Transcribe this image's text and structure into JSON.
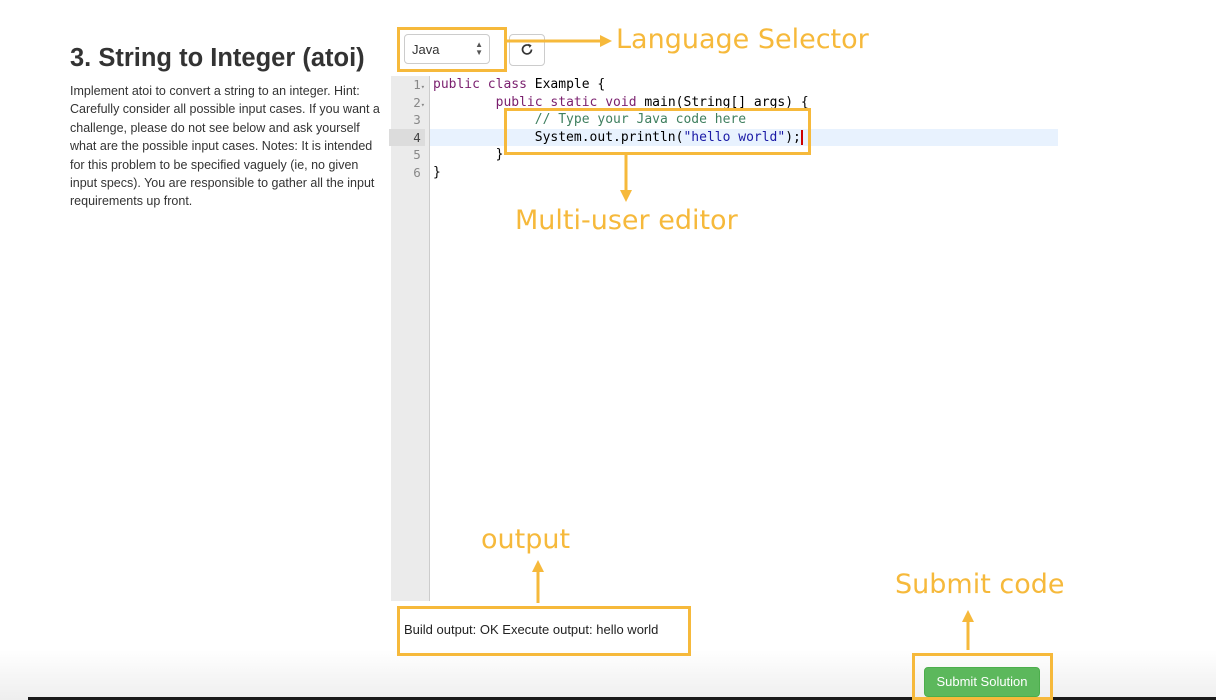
{
  "problem": {
    "title": "3. String to Integer (atoi)",
    "description": "Implement atoi to convert a string to an integer. Hint: Carefully consider all possible input cases. If you want a challenge, please do not see below and ask yourself what are the possible input cases. Notes: It is intended for this problem to be specified vaguely (ie, no given input specs). You are responsible to gather all the input requirements up front."
  },
  "toolbar": {
    "language_value": "Java",
    "refresh_icon": "refresh-icon"
  },
  "editor": {
    "line_numbers": [
      "1",
      "2",
      "3",
      "4",
      "5",
      "6"
    ],
    "active_line": 4,
    "lines": {
      "l1": [
        "public",
        " ",
        "class",
        " Example {"
      ],
      "l2": [
        "public",
        " ",
        "static",
        " ",
        "void",
        " main(String[] args) {"
      ],
      "l3": "// Type your Java code here",
      "l4": [
        "System.out.println(",
        "\"hello world\"",
        ");"
      ],
      "l5": "}",
      "l6": "}"
    }
  },
  "output": {
    "text": "Build output: OK Execute output: hello world"
  },
  "submit": {
    "label": "Submit Solution"
  },
  "annotations": {
    "language_selector": "Language Selector",
    "multi_user_editor": "Multi-user editor",
    "output": "output",
    "submit_code": "Submit code",
    "color": "#f6b93b"
  },
  "theme": {
    "submit_green": "#5cb85c",
    "active_line_bg": "#e8f2fe",
    "keyword_color": "#7a1f6e",
    "comment_color": "#3f7f5f",
    "string_color": "#1a1aa6"
  }
}
